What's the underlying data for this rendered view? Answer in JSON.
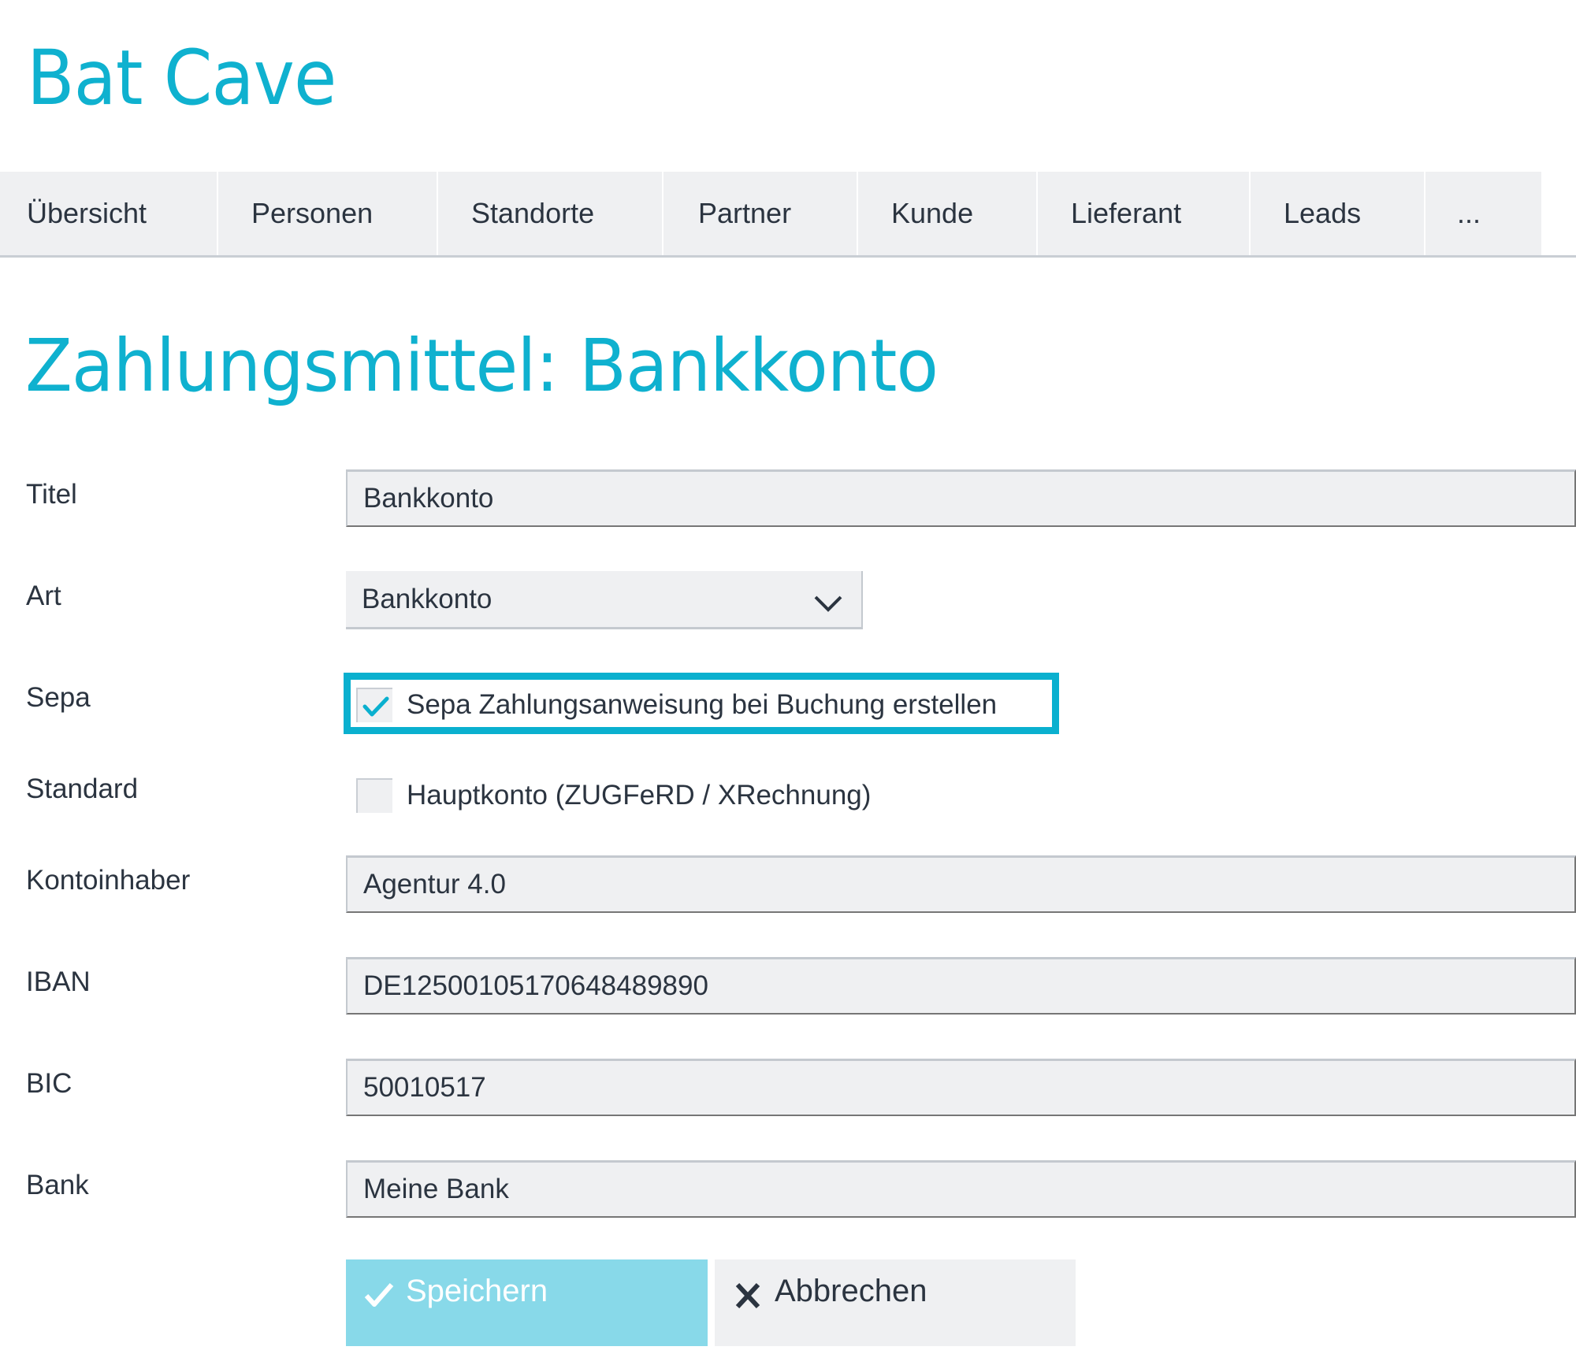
{
  "app": {
    "title": "Bat Cave"
  },
  "tabs": [
    {
      "label": "Übersicht"
    },
    {
      "label": "Personen"
    },
    {
      "label": "Standorte"
    },
    {
      "label": "Partner"
    },
    {
      "label": "Kunde"
    },
    {
      "label": "Lieferant"
    },
    {
      "label": "Leads"
    },
    {
      "label": "..."
    }
  ],
  "page": {
    "heading": "Zahlungsmittel: Bankkonto"
  },
  "form": {
    "titel": {
      "label": "Titel",
      "value": "Bankkonto"
    },
    "art": {
      "label": "Art",
      "value": "Bankkonto"
    },
    "sepa": {
      "label": "Sepa",
      "checkbox_label": "Sepa Zahlungsanweisung bei Buchung erstellen",
      "checked": true
    },
    "standard": {
      "label": "Standard",
      "checkbox_label": "Hauptkonto (ZUGFeRD / XRechnung)",
      "checked": false
    },
    "kontoinhaber": {
      "label": "Kontoinhaber",
      "value": "Agentur 4.0"
    },
    "iban": {
      "label": "IBAN",
      "value": "DE12500105170648489890"
    },
    "bic": {
      "label": "BIC",
      "value": "50010517"
    },
    "bank": {
      "label": "Bank",
      "value": "Meine Bank"
    }
  },
  "actions": {
    "save_label": "Speichern",
    "cancel_label": "Abbrechen"
  },
  "colors": {
    "accent": "#0fb1cf",
    "save_button": "#88d9e9",
    "field_bg": "#eff0f2"
  }
}
